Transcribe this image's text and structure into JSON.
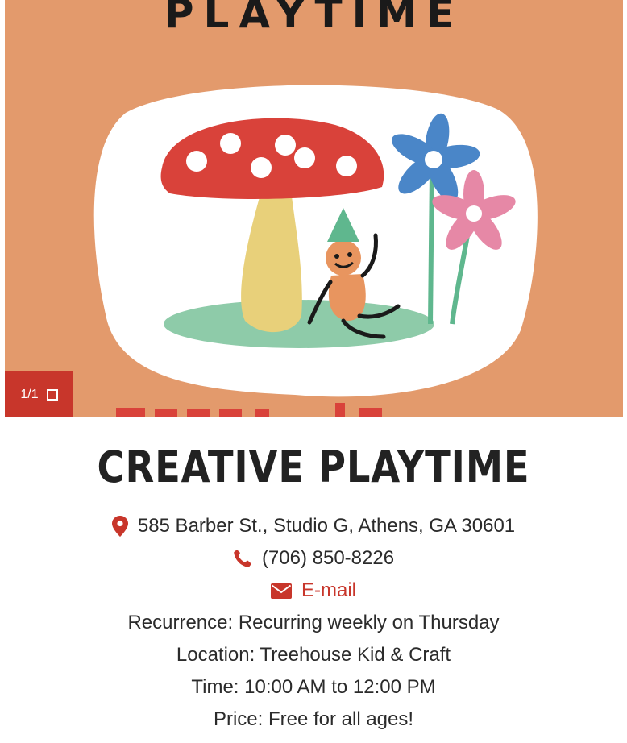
{
  "hero": {
    "image_text": "PLAYTIME",
    "counter": "1/1",
    "counter_icon": "fullscreen-icon",
    "colors": {
      "background": "#e39a6c",
      "accent": "#c8362b"
    }
  },
  "event": {
    "title": "CREATIVE PLAYTIME",
    "address": "585 Barber St., Studio G, Athens, GA 30601",
    "phone": "(706) 850-8226",
    "email_label": "E-mail",
    "recurrence": "Recurrence: Recurring weekly on Thursday",
    "location": "Location: Treehouse Kid & Craft",
    "time": "Time: 10:00 AM to 12:00 PM",
    "price": "Price: Free for all ages!"
  },
  "icons": [
    "map-pin-icon",
    "phone-icon",
    "envelope-icon"
  ]
}
